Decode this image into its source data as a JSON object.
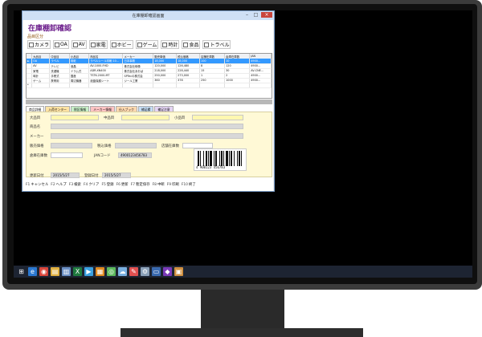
{
  "window": {
    "title": "在庫棚卸確認画面"
  },
  "app": {
    "heading": "在庫棚卸確認",
    "category_label": "品目区分",
    "categories": [
      "カメラ",
      "OA",
      "AV",
      "家電",
      "ホビー",
      "ゲーム",
      "時計",
      "食品",
      "トラベル"
    ]
  },
  "grid": {
    "columns": [
      "",
      "大品目",
      "中品目",
      "小品目",
      "商品名",
      "メーカー",
      "販売単価",
      "税込価格",
      "店舗在庫数",
      "倉庫在庫数",
      "JAN"
    ],
    "rows": [
      {
        "cells": [
          "►",
          "OA",
          "ラベル",
          "用紙",
          "ラベルシール印刷 10...",
          "日本事務",
          "18,000",
          "18,000",
          "100",
          "10",
          "4900..."
        ],
        "selected": true
      },
      {
        "cells": [
          "",
          "AV",
          "テレビ",
          "液晶",
          "AV-1000-FHD",
          "株式会社映像",
          "120,000",
          "126,480",
          "8",
          "120",
          "4900..."
        ],
        "selected": false
      },
      {
        "cells": [
          "",
          "家電",
          "洗濯機",
          "ドラム式",
          "ADR-XN400",
          "株式会社あおば",
          "218,000",
          "228,440",
          "15",
          "30",
          "AV-CNE..."
        ],
        "selected": false
      },
      {
        "cells": [
          "",
          "時計",
          "手巻式",
          "国産",
          "TSTK-2000-MT",
          "SPTecの株式会",
          "250,000",
          "273,000",
          "1",
          "2",
          "4900..."
        ],
        "selected": false
      },
      {
        "cells": [
          "",
          "ゲーム",
          "携帯用",
          "周辺機器",
          "液晶保護シート",
          "ジール工業",
          "360",
          "378",
          "250",
          "1000",
          "4900..."
        ],
        "selected": false
      },
      {
        "cells": [
          "*",
          "",
          "",
          "",
          "",
          "",
          "",
          "",
          "",
          "",
          ""
        ],
        "selected": false
      }
    ]
  },
  "tabs": [
    {
      "label": "商品詳細",
      "color": "#ffffff"
    },
    {
      "label": "入荷センター",
      "color": "#ffe3a3"
    },
    {
      "label": "税区情報",
      "color": "#c8f0c8"
    },
    {
      "label": "メーカー情報",
      "color": "#ffc4c4"
    },
    {
      "label": "仕入ブック",
      "color": "#ffd9b0"
    },
    {
      "label": "補足欄",
      "color": "#c4dcf4"
    },
    {
      "label": "補足注意",
      "color": "#e4d4f4"
    }
  ],
  "detail": {
    "labels": {
      "large": "大品目",
      "medium": "中品目",
      "small": "小品目",
      "product": "商品名",
      "maker": "メーカー",
      "price": "販売価格",
      "tax_price": "税込価格",
      "store_stock": "店舗在庫数",
      "warehouse_stock": "倉庫在庫数",
      "jan": "JANコード",
      "updated": "更新日付",
      "registered": "登録日付"
    },
    "jan_value": "4900123456783",
    "barcode_text": "4 900123 456783",
    "updated_value": "2015/5/27",
    "registered_value": "2015/5/27"
  },
  "toolbar": {
    "buttons": [
      {
        "key": "F1",
        "label": "キャンセル"
      },
      {
        "key": "F2",
        "label": "ヘルプ"
      },
      {
        "key": "F3",
        "label": "検索"
      },
      {
        "key": "F4",
        "label": "クリア"
      },
      {
        "key": "F5",
        "label": "登録"
      },
      {
        "key": "F6",
        "label": "更新"
      },
      {
        "key": "F7",
        "label": "暫定保存"
      },
      {
        "key": "F8",
        "label": "中断"
      },
      {
        "key": "F9",
        "label": "印刷"
      },
      {
        "key": "F10",
        "label": "終了"
      }
    ]
  },
  "taskbar": {
    "icons": [
      "windows-start-icon",
      "ie-icon",
      "chrome-icon",
      "folder-icon",
      "document-icon",
      "excel-icon",
      "media-icon",
      "chart-icon",
      "network-icon",
      "cloud-icon",
      "paint-icon",
      "settings-icon",
      "window-icon",
      "visual-studio-icon",
      "app-icon"
    ]
  }
}
